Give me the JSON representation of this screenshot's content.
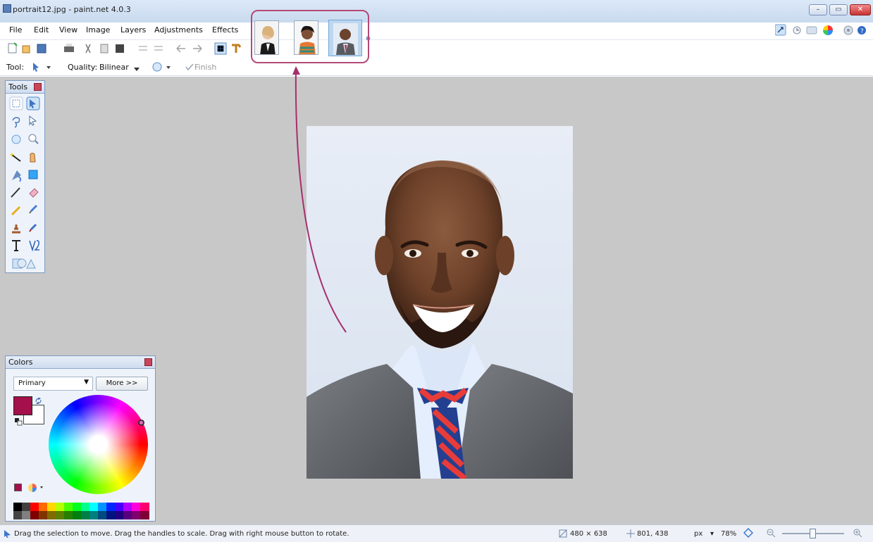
{
  "window": {
    "title": "portrait12.jpg - paint.net 4.0.3"
  },
  "menu": [
    "File",
    "Edit",
    "View",
    "Image",
    "Layers",
    "Adjustments",
    "Effects"
  ],
  "toolbar": {
    "tool_label": "Tool:",
    "quality_label": "Quality:",
    "quality_value": "Bilinear",
    "finish_label": "Finish"
  },
  "panels": {
    "tools_title": "Tools",
    "colors_title": "Colors",
    "color_mode": "Primary",
    "more_button": "More >>"
  },
  "status": {
    "hint": "Drag the selection to move. Drag the handles to scale. Drag with right mouse button to rotate.",
    "image_size": "480 × 638",
    "cursor_position": "801, 438",
    "units": "px",
    "zoom": "78%"
  },
  "colors": {
    "primary": "#a3104a",
    "secondary": "#ffffff",
    "accent_annotation": "#b44a78"
  },
  "icons": {
    "tools": [
      "rectangle-select-icon",
      "move-selection-icon",
      "lasso-select-icon",
      "move-selected-icon",
      "ellipse-select-icon",
      "zoom-icon",
      "magic-wand-icon",
      "pan-icon",
      "paint-bucket-icon",
      "gradient-icon",
      "paintbrush-icon",
      "eraser-icon",
      "pencil-icon",
      "color-picker-icon",
      "clone-stamp-icon",
      "recolor-icon",
      "text-icon",
      "line-curve-icon",
      "shapes-icon"
    ]
  }
}
